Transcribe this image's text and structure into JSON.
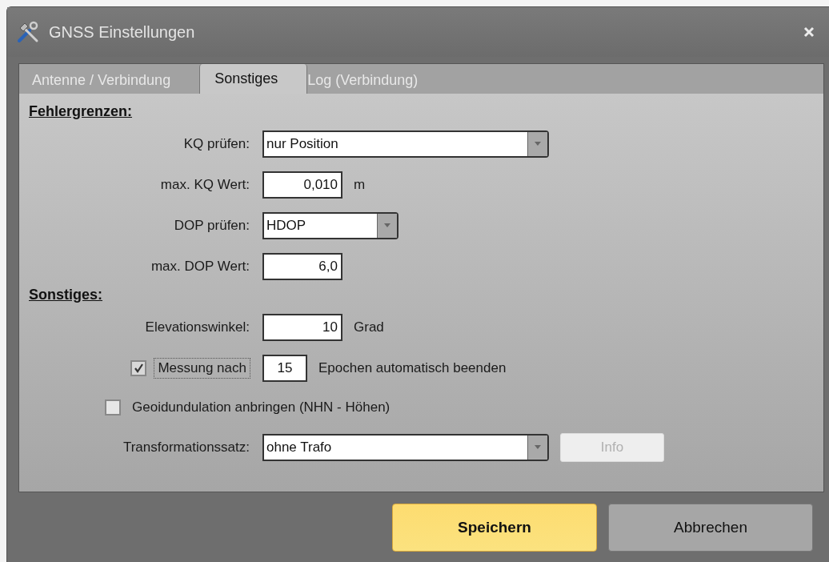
{
  "window": {
    "title": "GNSS Einstellungen"
  },
  "tabs": [
    {
      "label": "Antenne / Verbindung",
      "selected": false
    },
    {
      "label": "Sonstiges",
      "selected": true
    },
    {
      "label": "Log (Verbindung)",
      "selected": false
    }
  ],
  "sections": [
    {
      "heading": "Fehlergrenzen:",
      "rows": [
        {
          "kind": "combo",
          "label": "KQ prüfen:",
          "value": "nur Position"
        },
        {
          "kind": "number",
          "label": "max. KQ Wert:",
          "value": "0,010",
          "unit": "m"
        },
        {
          "kind": "combo",
          "label": "DOP prüfen:",
          "value": "HDOP"
        },
        {
          "kind": "number",
          "label": "max. DOP Wert:",
          "value": "6,0"
        }
      ]
    },
    {
      "heading": "Sonstiges:",
      "rows": [
        {
          "kind": "number",
          "label": "Elevationswinkel:",
          "value": "10",
          "unit": "Grad"
        },
        {
          "kind": "check",
          "checked": true,
          "focused": true,
          "label": "Messung nach",
          "value": "15",
          "unit": "Epochen automatisch beenden"
        },
        {
          "kind": "check",
          "checked": false,
          "focused": false,
          "label": "Geoidundulation anbringen (NHN - Höhen)"
        },
        {
          "kind": "combo",
          "label": "Transformationssatz:",
          "value": "ohne Trafo",
          "button": {
            "label": "Info",
            "disabled": true
          }
        }
      ]
    }
  ],
  "buttons": [
    {
      "label": "Speichern",
      "default": true
    },
    {
      "label": "Abbrechen",
      "default": false
    }
  ]
}
